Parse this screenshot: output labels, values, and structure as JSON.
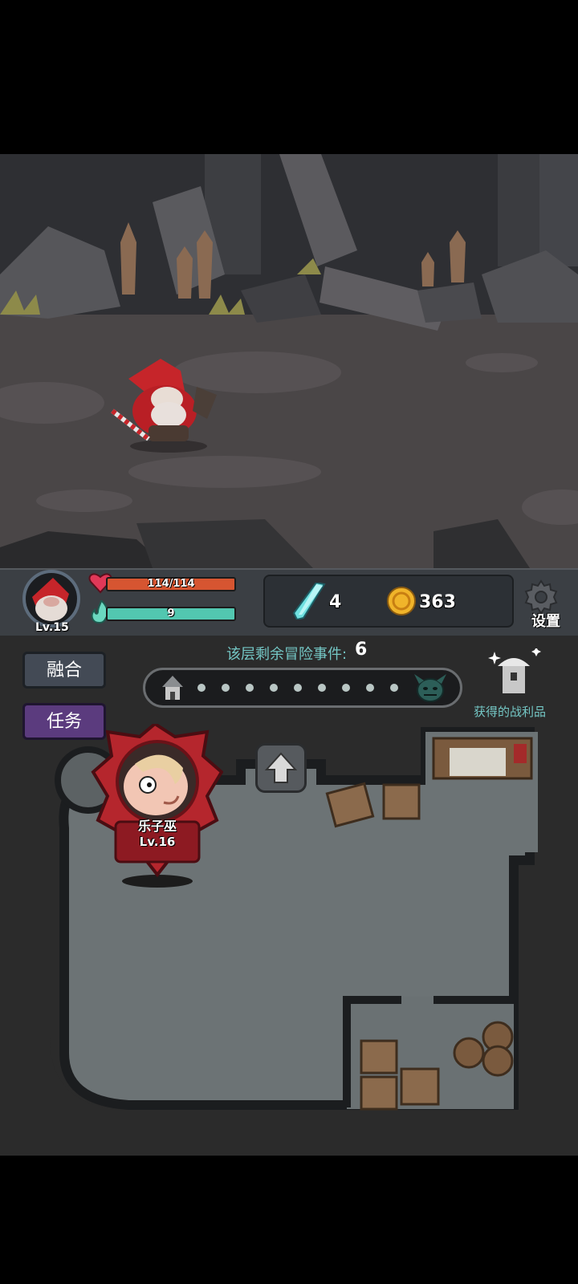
{
  "player": {
    "level": "Lv.15",
    "hp_text": "114/114",
    "hp_fraction": 1.0,
    "mana_text": "9",
    "mana_fraction": 1.0
  },
  "resources": {
    "crystal_count": "4",
    "gold_count": "363"
  },
  "settings": {
    "label": "设置"
  },
  "sidebar": {
    "merge_label": "融合",
    "quest_label": "任务"
  },
  "floor": {
    "events_label": "该层剩余冒险事件:",
    "events_count": "6",
    "progress_dots": 9
  },
  "loot": {
    "label": "获得的战利品"
  },
  "enemy": {
    "name": "乐子巫",
    "level": "Lv.16"
  },
  "colors": {
    "hp": "#d65531",
    "mana": "#52c7b0",
    "merge_button": "#434a55",
    "quest_button": "#5b3b7e"
  }
}
